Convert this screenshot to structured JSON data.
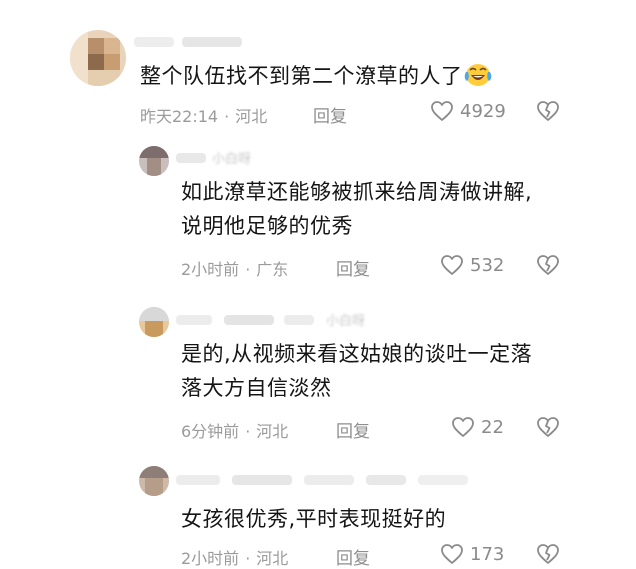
{
  "comments": [
    {
      "author_blurred": "",
      "content_lines": [
        "整个队伍找不到第二个潦草的人了"
      ],
      "emoji": "laughing-tears-emoji",
      "time": "昨天22:14",
      "location": "河北",
      "reply_label": "回复",
      "likes": "4929"
    },
    {
      "author_blurred": "小白呀",
      "content_lines": [
        "如此潦草还能够被抓来给周涛做讲解,",
        "说明他足够的优秀"
      ],
      "time": "2小时前",
      "location": "广东",
      "reply_label": "回复",
      "likes": "532"
    },
    {
      "author_blurred": "小白呀",
      "content_lines": [
        "是的,从视频来看这姑娘的谈吐一定落",
        "落大方自信淡然"
      ],
      "time": "6分钟前",
      "location": "河北",
      "reply_label": "回复",
      "likes": "22"
    },
    {
      "author_blurred": "",
      "content_lines": [
        "女孩很优秀,平时表现挺好的"
      ],
      "time": "2小时前",
      "location": "河北",
      "reply_label": "回复",
      "likes": "173"
    }
  ],
  "separator": "·",
  "colors": {
    "text": "#151515",
    "meta": "#9b9b9b",
    "icon": "#8a8a8a"
  }
}
